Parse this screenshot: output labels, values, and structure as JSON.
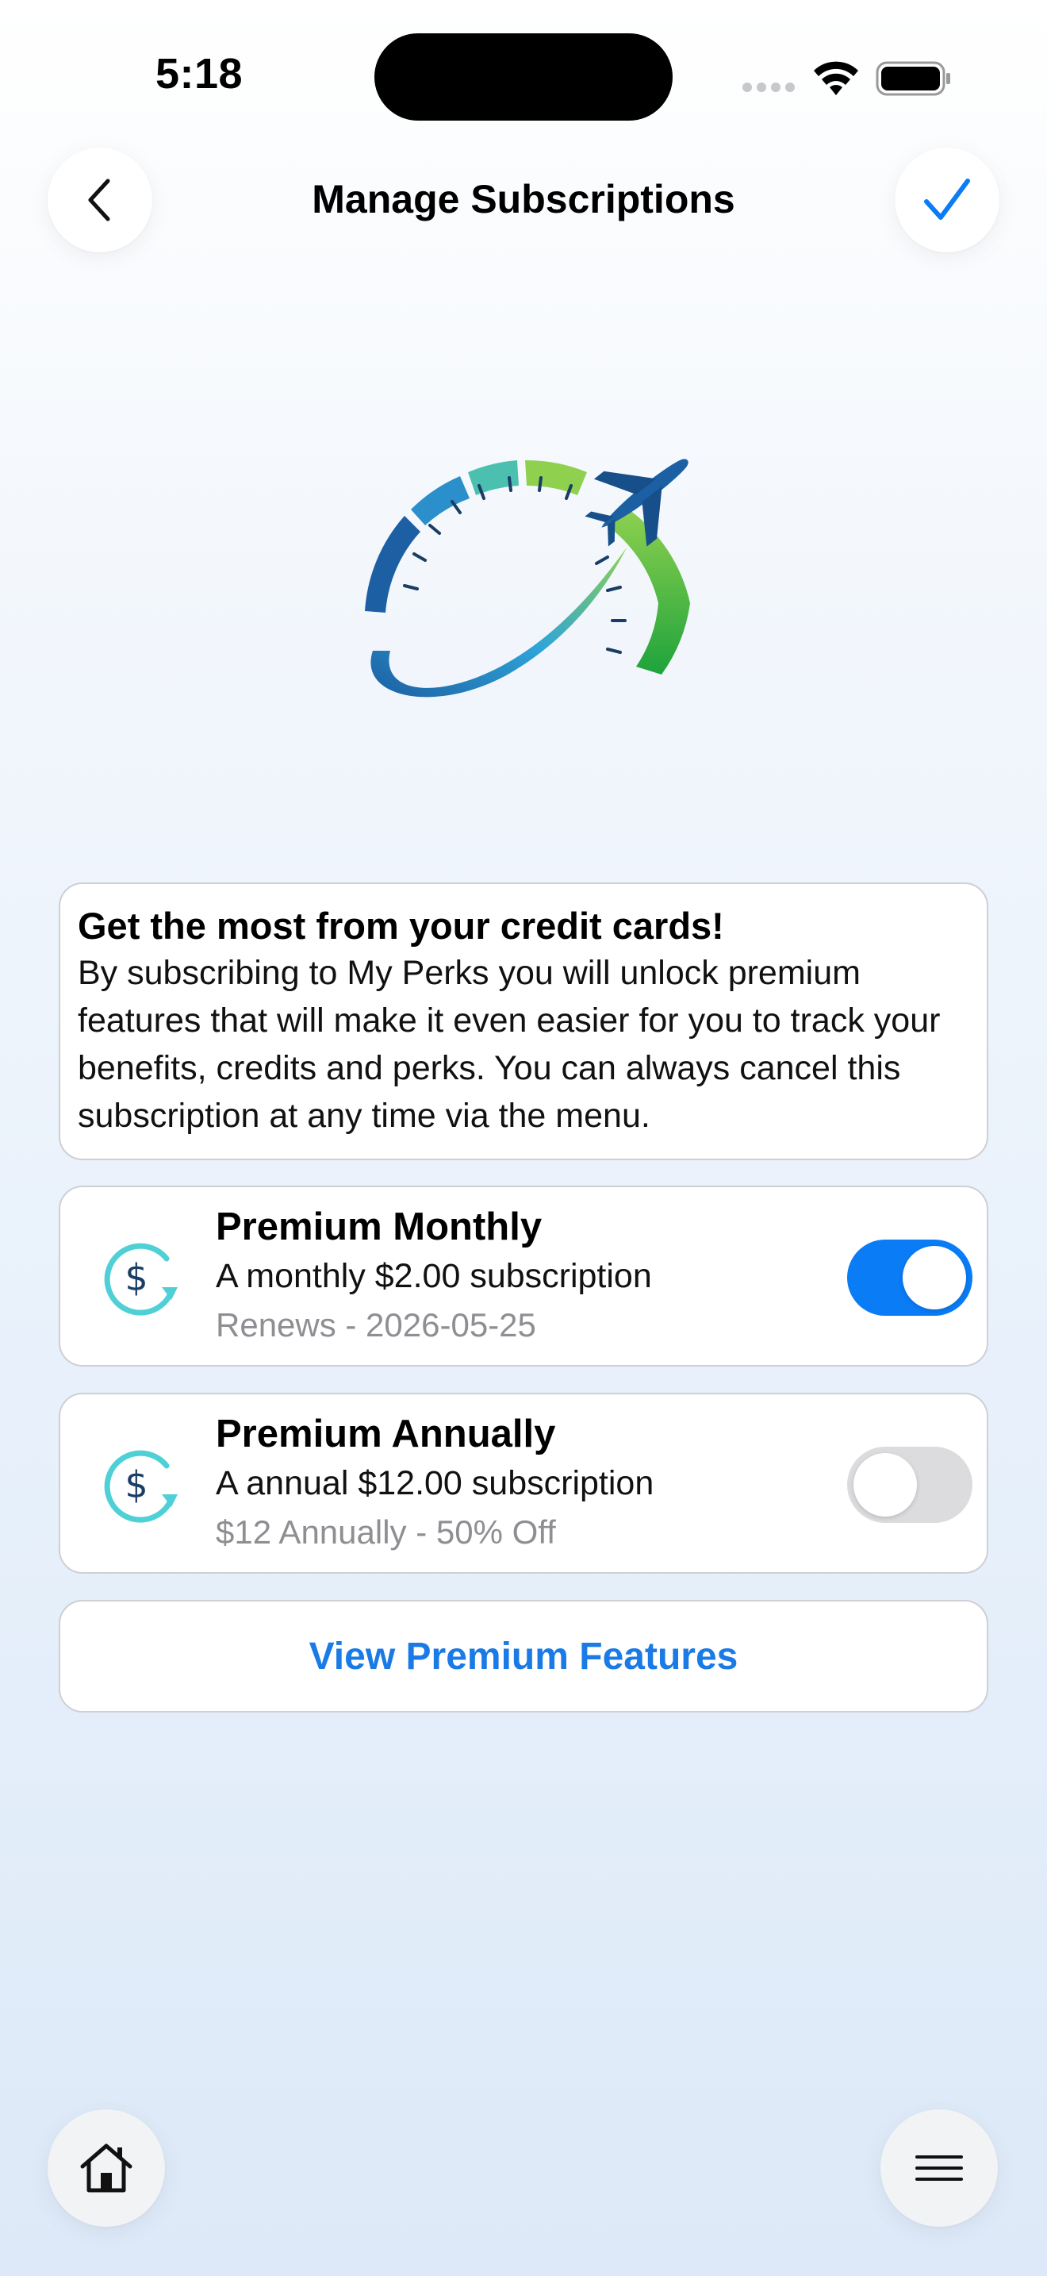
{
  "status_bar": {
    "time": "5:18"
  },
  "header": {
    "title": "Manage Subscriptions"
  },
  "icons": {
    "back": "chevron-left-icon",
    "done": "checkmark-icon",
    "home": "house-icon",
    "menu": "hamburger-menu-icon",
    "subscription": "dollar-renew-icon"
  },
  "colors": {
    "accent": "#0a7cf6",
    "link": "#1a7be6",
    "toggle_off": "#dcdcdf",
    "muted_text": "#8e8e93"
  },
  "info": {
    "title": "Get the most from your credit cards!",
    "body": "By subscribing to My Perks you will unlock premium features that will make it even easier for you to track your benefits, credits and perks. You can always cancel this subscription at any time via the menu."
  },
  "subscriptions": [
    {
      "title": "Premium Monthly",
      "description": "A monthly $2.00 subscription",
      "note": "Renews - 2026-05-25",
      "enabled": true
    },
    {
      "title": "Premium Annually",
      "description": "A annual $12.00 subscription",
      "note": "$12 Annually - 50% Off",
      "enabled": false
    }
  ],
  "actions": {
    "view_features": "View Premium Features"
  }
}
